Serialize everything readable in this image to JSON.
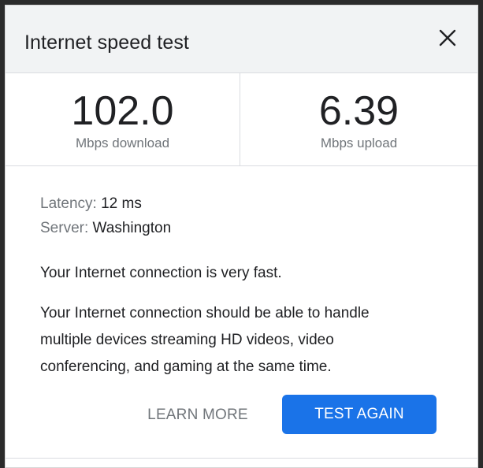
{
  "dialog": {
    "title": "Internet speed test",
    "close_icon": "close-icon"
  },
  "results": {
    "download": {
      "value": "102.0",
      "unit": "Mbps download"
    },
    "upload": {
      "value": "6.39",
      "unit": "Mbps upload"
    }
  },
  "details": {
    "latency_label": "Latency:",
    "latency_value": "12 ms",
    "server_label": "Server:",
    "server_value": "Washington"
  },
  "summary": "Your Internet connection is very fast.",
  "description": "Your Internet connection should be able to handle multiple devices streaming HD videos, video conferencing, and gaming at the same time.",
  "actions": {
    "learn_more": "LEARN MORE",
    "test_again": "TEST AGAIN"
  },
  "colors": {
    "primary": "#1a73e8",
    "header_bg": "#f1f3f4",
    "text": "#202124",
    "muted": "#70757a"
  }
}
